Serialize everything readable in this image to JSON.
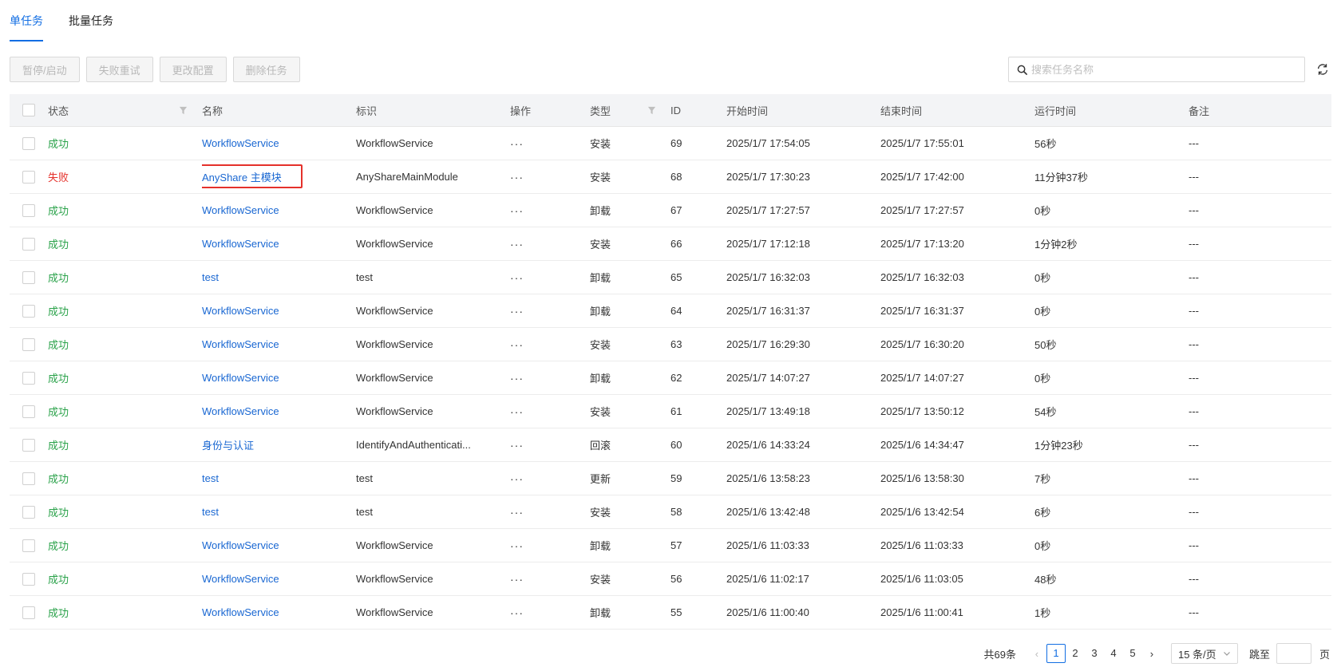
{
  "tabs": [
    {
      "label": "单任务",
      "active": true
    },
    {
      "label": "批量任务",
      "active": false
    }
  ],
  "toolbar": {
    "pause_start": "暂停/启动",
    "retry_failed": "失败重试",
    "change_config": "更改配置",
    "delete_task": "删除任务"
  },
  "search": {
    "placeholder": "搜索任务名称"
  },
  "columns": {
    "status": "状态",
    "name": "名称",
    "tag": "标识",
    "op": "操作",
    "type": "类型",
    "id": "ID",
    "start": "开始时间",
    "end": "结束时间",
    "run": "运行时间",
    "note": "备注"
  },
  "rows": [
    {
      "status": "成功",
      "name": "WorkflowService",
      "tag": "WorkflowService",
      "op": "···",
      "type": "安装",
      "id": "69",
      "start": "2025/1/7 17:54:05",
      "end": "2025/1/7 17:55:01",
      "run": "56秒",
      "note": "---"
    },
    {
      "status": "失败",
      "name": "AnyShare 主模块",
      "tag": "AnyShareMainModule",
      "op": "···",
      "type": "安装",
      "id": "68",
      "start": "2025/1/7 17:30:23",
      "end": "2025/1/7 17:42:00",
      "run": "11分钟37秒",
      "note": "---"
    },
    {
      "status": "成功",
      "name": "WorkflowService",
      "tag": "WorkflowService",
      "op": "···",
      "type": "卸载",
      "id": "67",
      "start": "2025/1/7 17:27:57",
      "end": "2025/1/7 17:27:57",
      "run": "0秒",
      "note": "---"
    },
    {
      "status": "成功",
      "name": "WorkflowService",
      "tag": "WorkflowService",
      "op": "···",
      "type": "安装",
      "id": "66",
      "start": "2025/1/7 17:12:18",
      "end": "2025/1/7 17:13:20",
      "run": "1分钟2秒",
      "note": "---"
    },
    {
      "status": "成功",
      "name": "test",
      "tag": "test",
      "op": "···",
      "type": "卸载",
      "id": "65",
      "start": "2025/1/7 16:32:03",
      "end": "2025/1/7 16:32:03",
      "run": "0秒",
      "note": "---"
    },
    {
      "status": "成功",
      "name": "WorkflowService",
      "tag": "WorkflowService",
      "op": "···",
      "type": "卸载",
      "id": "64",
      "start": "2025/1/7 16:31:37",
      "end": "2025/1/7 16:31:37",
      "run": "0秒",
      "note": "---"
    },
    {
      "status": "成功",
      "name": "WorkflowService",
      "tag": "WorkflowService",
      "op": "···",
      "type": "安装",
      "id": "63",
      "start": "2025/1/7 16:29:30",
      "end": "2025/1/7 16:30:20",
      "run": "50秒",
      "note": "---"
    },
    {
      "status": "成功",
      "name": "WorkflowService",
      "tag": "WorkflowService",
      "op": "···",
      "type": "卸载",
      "id": "62",
      "start": "2025/1/7 14:07:27",
      "end": "2025/1/7 14:07:27",
      "run": "0秒",
      "note": "---"
    },
    {
      "status": "成功",
      "name": "WorkflowService",
      "tag": "WorkflowService",
      "op": "···",
      "type": "安装",
      "id": "61",
      "start": "2025/1/7 13:49:18",
      "end": "2025/1/7 13:50:12",
      "run": "54秒",
      "note": "---"
    },
    {
      "status": "成功",
      "name": "身份与认证",
      "tag": "IdentifyAndAuthenticati...",
      "op": "···",
      "type": "回滚",
      "id": "60",
      "start": "2025/1/6 14:33:24",
      "end": "2025/1/6 14:34:47",
      "run": "1分钟23秒",
      "note": "---"
    },
    {
      "status": "成功",
      "name": "test",
      "tag": "test",
      "op": "···",
      "type": "更新",
      "id": "59",
      "start": "2025/1/6 13:58:23",
      "end": "2025/1/6 13:58:30",
      "run": "7秒",
      "note": "---"
    },
    {
      "status": "成功",
      "name": "test",
      "tag": "test",
      "op": "···",
      "type": "安装",
      "id": "58",
      "start": "2025/1/6 13:42:48",
      "end": "2025/1/6 13:42:54",
      "run": "6秒",
      "note": "---"
    },
    {
      "status": "成功",
      "name": "WorkflowService",
      "tag": "WorkflowService",
      "op": "···",
      "type": "卸载",
      "id": "57",
      "start": "2025/1/6 11:03:33",
      "end": "2025/1/6 11:03:33",
      "run": "0秒",
      "note": "---"
    },
    {
      "status": "成功",
      "name": "WorkflowService",
      "tag": "WorkflowService",
      "op": "···",
      "type": "安装",
      "id": "56",
      "start": "2025/1/6 11:02:17",
      "end": "2025/1/6 11:03:05",
      "run": "48秒",
      "note": "---"
    },
    {
      "status": "成功",
      "name": "WorkflowService",
      "tag": "WorkflowService",
      "op": "···",
      "type": "卸载",
      "id": "55",
      "start": "2025/1/6 11:00:40",
      "end": "2025/1/6 11:00:41",
      "run": "1秒",
      "note": "---"
    }
  ],
  "highlighted_row": 1,
  "colors": {
    "accent": "#126ee3",
    "success": "#2aa24a",
    "fail": "#e5312b",
    "link": "#1967d2"
  },
  "pagination": {
    "total": "共69条",
    "pages": [
      "1",
      "2",
      "3",
      "4",
      "5"
    ],
    "current": "1",
    "page_size": "15 条/页",
    "jump_label": "跳至",
    "page_label": "页"
  }
}
